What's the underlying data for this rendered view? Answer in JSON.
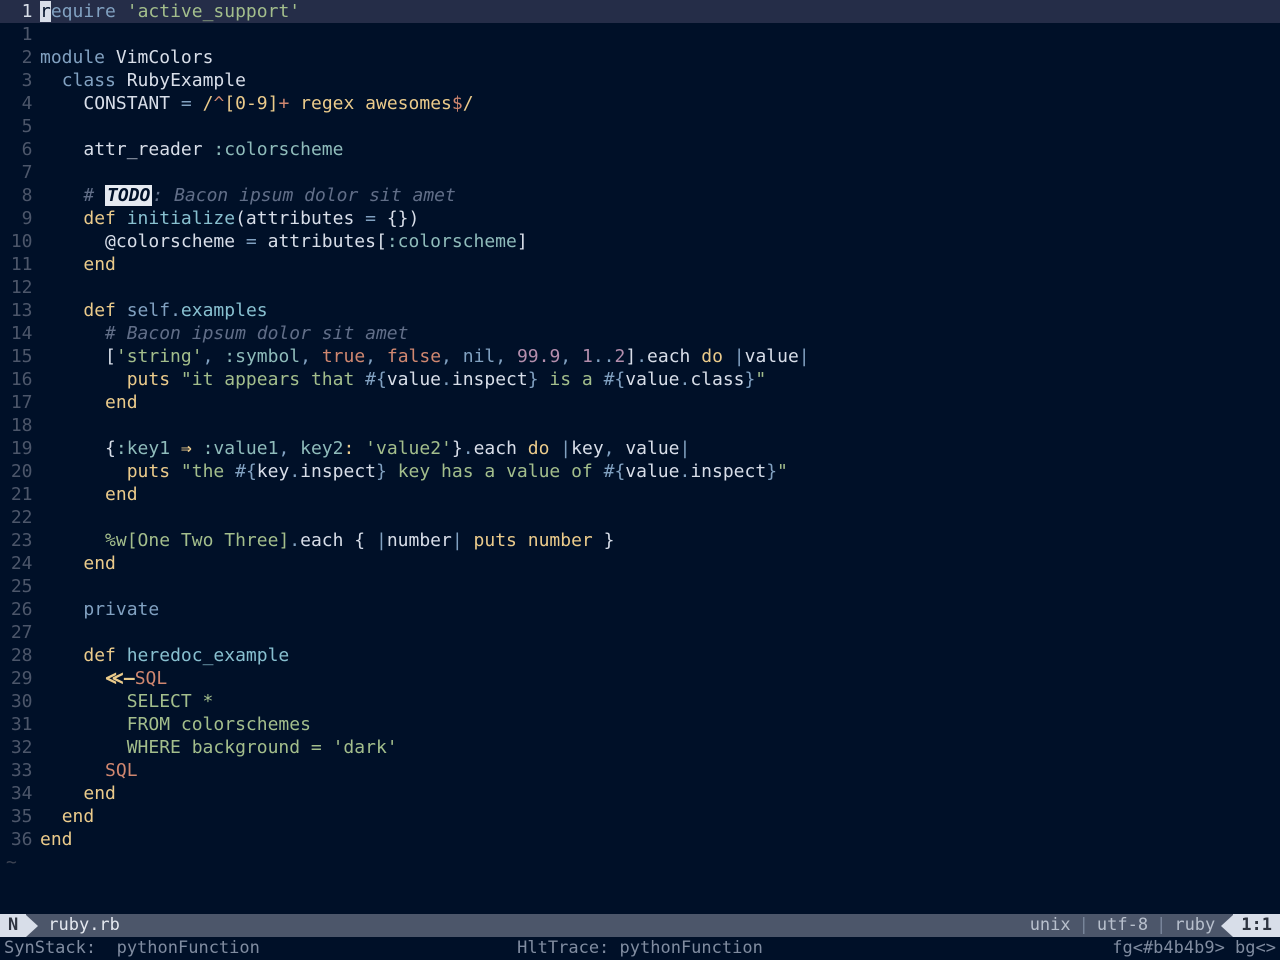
{
  "lines": [
    {
      "n": "  1",
      "cur": true,
      "html": "<span class='cursor'>r</span><span class='kw'>equire</span> <span class='delim'>'</span><span class='str'>active_support</span><span class='delim'>'</span>"
    },
    {
      "n": "  1",
      "html": ""
    },
    {
      "n": "  2",
      "html": "<span class='kw'>module</span> <span class='const'>VimColors</span>"
    },
    {
      "n": "  3",
      "html": "  <span class='kw'>class</span> <span class='const'>RubyExample</span>"
    },
    {
      "n": "  4",
      "html": "    <span class='const'>CONSTANT</span> <span class='op'>=</span> <span class='regex'>/</span><span class='orange2'>^</span><span class='regex'>[0-9]</span><span class='orange2'>+</span><span class='regex'> regex awesomes</span><span class='orange2'>$</span><span class='regex'>/</span>"
    },
    {
      "n": "  5",
      "html": ""
    },
    {
      "n": "  6",
      "html": "    <span class='ident'>attr_reader</span> <span class='sym'>:colorscheme</span>"
    },
    {
      "n": "  7",
      "html": ""
    },
    {
      "n": "  8",
      "html": "    <span class='cmt'># </span><span class='todo'>TODO</span><span class='cmt'>: Bacon ipsum dolor sit amet</span>"
    },
    {
      "n": "  9",
      "html": "    <span class='orange'>def</span> <span class='def'>initialize</span>(attributes <span class='op'>=</span> {})"
    },
    {
      "n": " 10",
      "html": "      <span class='ident'>@colorscheme</span> <span class='op'>=</span> attributes[<span class='sym'>:colorscheme</span>]"
    },
    {
      "n": " 11",
      "html": "    <span class='orange'>end</span>"
    },
    {
      "n": " 12",
      "html": ""
    },
    {
      "n": " 13",
      "html": "    <span class='orange'>def</span> <span class='kw'>self</span><span class='op'>.</span><span class='def'>examples</span>"
    },
    {
      "n": " 14",
      "html": "      <span class='cmt'># Bacon ipsum dolor sit amet</span>"
    },
    {
      "n": " 15",
      "html": "      [<span class='delim'>'</span><span class='str'>string</span><span class='delim'>'</span><span class='op'>,</span> <span class='sym'>:symbol</span><span class='op'>,</span> <span class='bool'>true</span><span class='op'>,</span> <span class='bool'>false</span><span class='op'>,</span> <span class='kw'>nil</span><span class='op'>,</span> <span class='num'>99.9</span><span class='op'>,</span> <span class='num'>1</span><span class='op'>..</span><span class='num'>2</span>]<span class='op'>.</span>each <span class='orange'>do</span> <span class='op'>|</span>value<span class='op'>|</span>"
    },
    {
      "n": " 16",
      "html": "        <span class='orange'>puts</span> <span class='delim'>\"</span><span class='str'>it appears that </span><span class='op'>#{</span>value<span class='op'>.</span>inspect<span class='op'>}</span><span class='str'> is a </span><span class='op'>#{</span>value<span class='op'>.</span>class<span class='op'>}</span><span class='delim'>\"</span>"
    },
    {
      "n": " 17",
      "html": "      <span class='orange'>end</span>"
    },
    {
      "n": " 18",
      "html": ""
    },
    {
      "n": " 19",
      "html": "      {<span class='sym'>:key1</span> <span class='arrow'>⇒</span> <span class='sym'>:value1</span><span class='op'>,</span> <span class='sym'>key2</span><span class='orange'>:</span> <span class='delim'>'</span><span class='str'>value2</span><span class='delim'>'</span>}<span class='op'>.</span>each <span class='orange'>do</span> <span class='op'>|</span>key<span class='op'>,</span> value<span class='op'>|</span>"
    },
    {
      "n": " 20",
      "html": "        <span class='orange'>puts</span> <span class='delim'>\"</span><span class='str'>the </span><span class='op'>#{</span>key<span class='op'>.</span>inspect<span class='op'>}</span><span class='str'> key has a value of </span><span class='op'>#{</span>value<span class='op'>.</span>inspect<span class='op'>}</span><span class='delim'>\"</span>"
    },
    {
      "n": " 21",
      "html": "      <span class='orange'>end</span>"
    },
    {
      "n": " 22",
      "html": ""
    },
    {
      "n": " 23",
      "html": "      <span class='delim'>%w[</span><span class='str'>One Two Three</span><span class='delim'>]</span><span class='op'>.</span>each { <span class='op'>|</span>number<span class='op'>|</span> <span class='orange'>puts</span> <span class='orange'>number</span> }"
    },
    {
      "n": " 24",
      "html": "    <span class='orange'>end</span>"
    },
    {
      "n": " 25",
      "html": ""
    },
    {
      "n": " 26",
      "html": "    <span class='kw'>private</span>"
    },
    {
      "n": " 27",
      "html": ""
    },
    {
      "n": " 28",
      "html": "    <span class='orange'>def</span> <span class='def'>heredoc_example</span>"
    },
    {
      "n": " 29",
      "html": "      <span class='arrow'>≪—</span><span class='orange2'>SQL</span>"
    },
    {
      "n": " 30",
      "html": "<span class='str'>        SELECT *</span>"
    },
    {
      "n": " 31",
      "html": "<span class='str'>        FROM colorschemes</span>"
    },
    {
      "n": " 32",
      "html": "<span class='str'>        WHERE background = 'dark'</span>"
    },
    {
      "n": " 33",
      "html": "      <span class='orange2'>SQL</span>"
    },
    {
      "n": " 34",
      "html": "    <span class='orange'>end</span>"
    },
    {
      "n": " 35",
      "html": "  <span class='orange'>end</span>"
    },
    {
      "n": " 36",
      "html": "<span class='orange'>end</span>"
    }
  ],
  "status": {
    "mode": "N",
    "file": "ruby.rb",
    "unix": "unix",
    "enc": "utf-8",
    "ft": "ruby",
    "pos": "1:1"
  },
  "info": {
    "left": "SynStack:  pythonFunction",
    "mid": "HltTrace: pythonFunction",
    "right": "fg<#b4b4b9> bg<>"
  }
}
